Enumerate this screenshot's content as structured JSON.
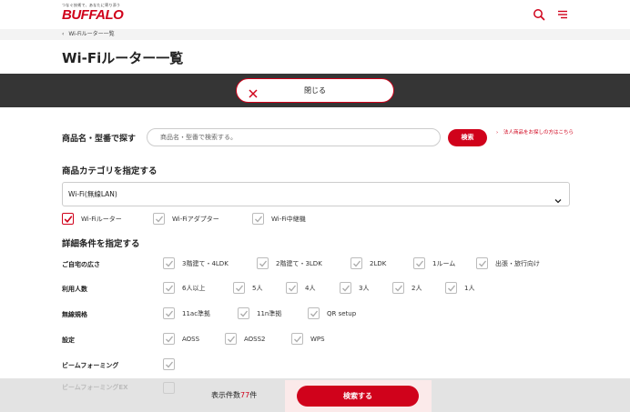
{
  "header": {
    "tagline": "つなぐ技術で、あなたに寄り添う",
    "logo": "BUFFALO",
    "icons": [
      "search-icon",
      "menu-icon"
    ]
  },
  "breadcrumb": {
    "arrow": "‹",
    "label": "Wi-Fiルーター一覧"
  },
  "page_title": "Wi-Fiルーター一覧",
  "close_button": {
    "label": "閉じる"
  },
  "search": {
    "label": "商品名・型番で探す",
    "placeholder": "商品名・型番で検索する。",
    "button": "検索",
    "corp_link_arrow": "›",
    "corp_link": "法人商品をお探しの方はこちら"
  },
  "category": {
    "title": "商品カテゴリを指定する",
    "select_value": "Wi-Fi(無線LAN)",
    "options": [
      {
        "label": "Wi-Fiルーター",
        "checked": true
      },
      {
        "label": "Wi-Fiアダプター",
        "checked": false
      },
      {
        "label": "Wi-Fi中継機",
        "checked": false
      }
    ]
  },
  "details": {
    "title": "詳細条件を指定する",
    "rows": [
      {
        "label": "ご自宅の広さ",
        "options": [
          "3階建て・4LDK",
          "2階建て・3LDK",
          "2LDK",
          "1ルーム",
          "出張・旅行向け"
        ]
      },
      {
        "label": "利用人数",
        "options": [
          "6人以上",
          "5人",
          "4人",
          "3人",
          "2人",
          "1人"
        ]
      },
      {
        "label": "無線規格",
        "options": [
          "11ac準拠",
          "11n準拠",
          "QR setup"
        ]
      },
      {
        "label": "設定",
        "options": [
          "AOSS",
          "AOSS2",
          "WPS"
        ]
      },
      {
        "label": "ビームフォーミング",
        "options": [
          ""
        ]
      },
      {
        "label": "ビームフォーミングEX",
        "options": [
          ""
        ]
      }
    ]
  },
  "footer": {
    "count_prefix": "表示件数",
    "count": "77",
    "count_suffix": "件",
    "search_button": "検索する"
  },
  "colors": {
    "accent": "#d0021b",
    "dark_bar": "#353535",
    "check": "#bbbbbb"
  }
}
